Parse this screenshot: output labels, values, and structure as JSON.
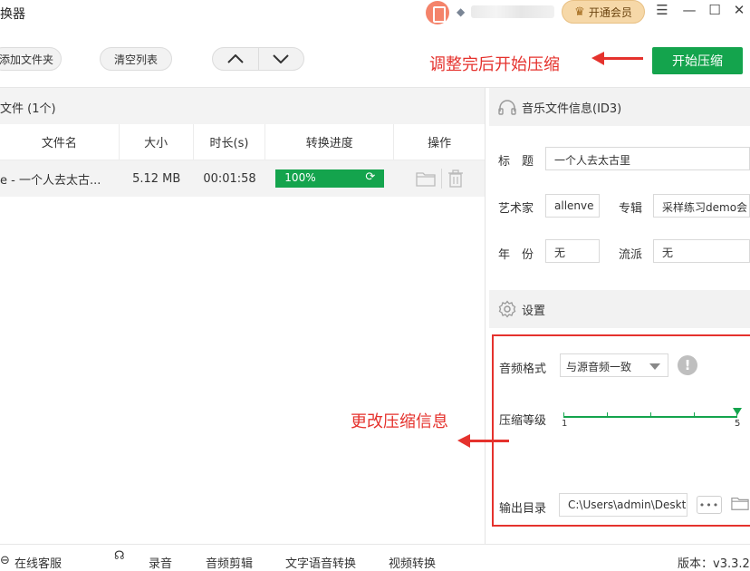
{
  "window": {
    "title": "换器",
    "vip_label": "开通会员",
    "controls": [
      "☰",
      "—",
      "☐",
      "✕"
    ]
  },
  "toolbar": {
    "add_folder": "添加文件夹",
    "clear_list": "清空列表",
    "start": "开始压缩"
  },
  "annotations": {
    "top": "调整完后开始压缩",
    "settings": "更改压缩信息",
    "color": "#e5322d"
  },
  "files": {
    "header": "文件 (1个)",
    "columns": [
      "文件名",
      "大小",
      "时长(s)",
      "转换进度",
      "操作"
    ],
    "rows": [
      {
        "name": "e - 一个人去太古...",
        "size": "5.12 MB",
        "duration": "00:01:58",
        "progress_label": "100%",
        "progress": 1.0
      }
    ]
  },
  "id3": {
    "header": "音乐文件信息(ID3)",
    "title_label": "标　题",
    "title_value": "一个人去太古里",
    "artist_label": "艺术家",
    "artist_value": "allenve",
    "album_label": "专辑",
    "album_value": "采样练习demo会",
    "year_label": "年　份",
    "year_value": "无",
    "genre_label": "流派",
    "genre_value": "无"
  },
  "settings": {
    "header": "设置",
    "format_label": "音频格式",
    "format_value": "与源音频一致",
    "level_label": "压缩等级",
    "level_min": "1",
    "level_max": "5",
    "level_value": 5,
    "output_label": "输出目录",
    "output_value": "C:\\Users\\admin\\Desktop",
    "browse_label": "•••"
  },
  "statusbar": {
    "service": "在线客服",
    "record": "录音",
    "audio_cut": "音频剪辑",
    "tts": "文字语音转换",
    "video": "视频转换",
    "version": "版本：v3.3.2"
  },
  "colors": {
    "accent_green": "#14a44d",
    "vip_gold": "#f6d8a8"
  }
}
